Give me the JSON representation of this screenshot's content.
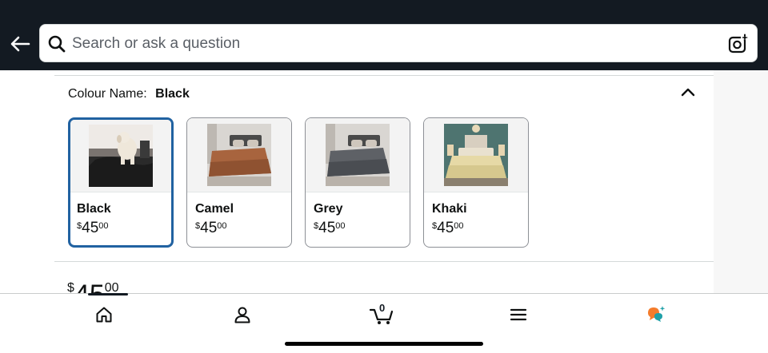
{
  "search": {
    "placeholder": "Search or ask a question"
  },
  "colour": {
    "label": "Colour Name:",
    "value": "Black"
  },
  "swatches": [
    {
      "name": "Black",
      "symbol": "$",
      "whole": "45",
      "fraction": "00",
      "selected": true
    },
    {
      "name": "Camel",
      "symbol": "$",
      "whole": "45",
      "fraction": "00",
      "selected": false
    },
    {
      "name": "Grey",
      "symbol": "$",
      "whole": "45",
      "fraction": "00",
      "selected": false
    },
    {
      "name": "Khaki",
      "symbol": "$",
      "whole": "45",
      "fraction": "00",
      "selected": false
    }
  ],
  "price_peek": {
    "symbol": "$",
    "whole": "45",
    "fraction": "00"
  },
  "nav": {
    "items": [
      "home-icon",
      "account-icon",
      "cart-icon",
      "menu-icon",
      "rufus-icon"
    ],
    "cart_count": "0"
  },
  "colors": {
    "header_bg": "#131a22",
    "selected_border": "#2162a1",
    "rufus_orange": "#f47c2c",
    "rufus_teal": "#1fa0a8"
  }
}
